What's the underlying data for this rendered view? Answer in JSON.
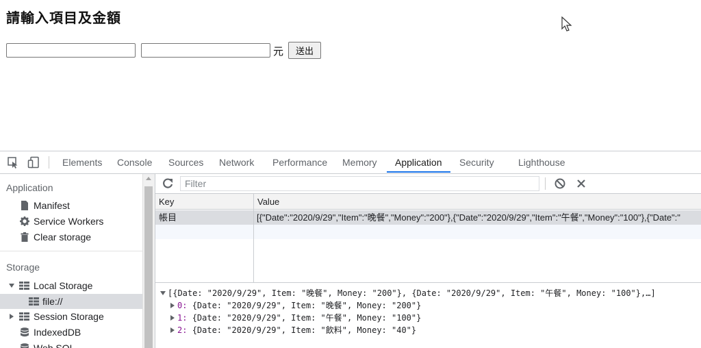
{
  "page": {
    "heading": "請輸入項目及金額",
    "item_input_value": "",
    "amount_input_value": "",
    "unit_label": "元",
    "submit_label": "送出"
  },
  "devtools": {
    "tabs": [
      "Elements",
      "Console",
      "Sources",
      "Network",
      "Performance",
      "Memory",
      "Application",
      "Security",
      "Lighthouse"
    ],
    "active_tab": "Application",
    "sidebar": {
      "application_section": "Application",
      "application_items": [
        "Manifest",
        "Service Workers",
        "Clear storage"
      ],
      "storage_section": "Storage",
      "local_storage": "Local Storage",
      "local_storage_child": "file://",
      "session_storage": "Session Storage",
      "indexeddb": "IndexedDB",
      "websql": "Web SQL"
    },
    "filter_placeholder": "Filter",
    "table": {
      "columns": [
        "Key",
        "Value"
      ],
      "rows": [
        {
          "key": "帳目",
          "value": "[{\"Date\":\"2020/9/29\",\"Item\":\"晚餐\",\"Money\":\"200\"},{\"Date\":\"2020/9/29\",\"Item\":\"午餐\",\"Money\":\"100\"},{\"Date\":\""
        }
      ]
    },
    "preview": {
      "summary": "[{Date: \"2020/9/29\", Item: \"晚餐\", Money: \"200\"}, {Date: \"2020/9/29\", Item: \"午餐\", Money: \"100\"},…]",
      "entries": [
        {
          "index": "0",
          "text": "{Date: \"2020/9/29\", Item: \"晚餐\", Money: \"200\"}"
        },
        {
          "index": "1",
          "text": "{Date: \"2020/9/29\", Item: \"午餐\", Money: \"100\"}"
        },
        {
          "index": "2",
          "text": "{Date: \"2020/9/29\", Item: \"飲料\", Money: \"40\"}"
        }
      ]
    }
  },
  "colors": {
    "accent": "#1a73e8",
    "selected_bg": "#dadce0",
    "index_color": "#881391"
  }
}
